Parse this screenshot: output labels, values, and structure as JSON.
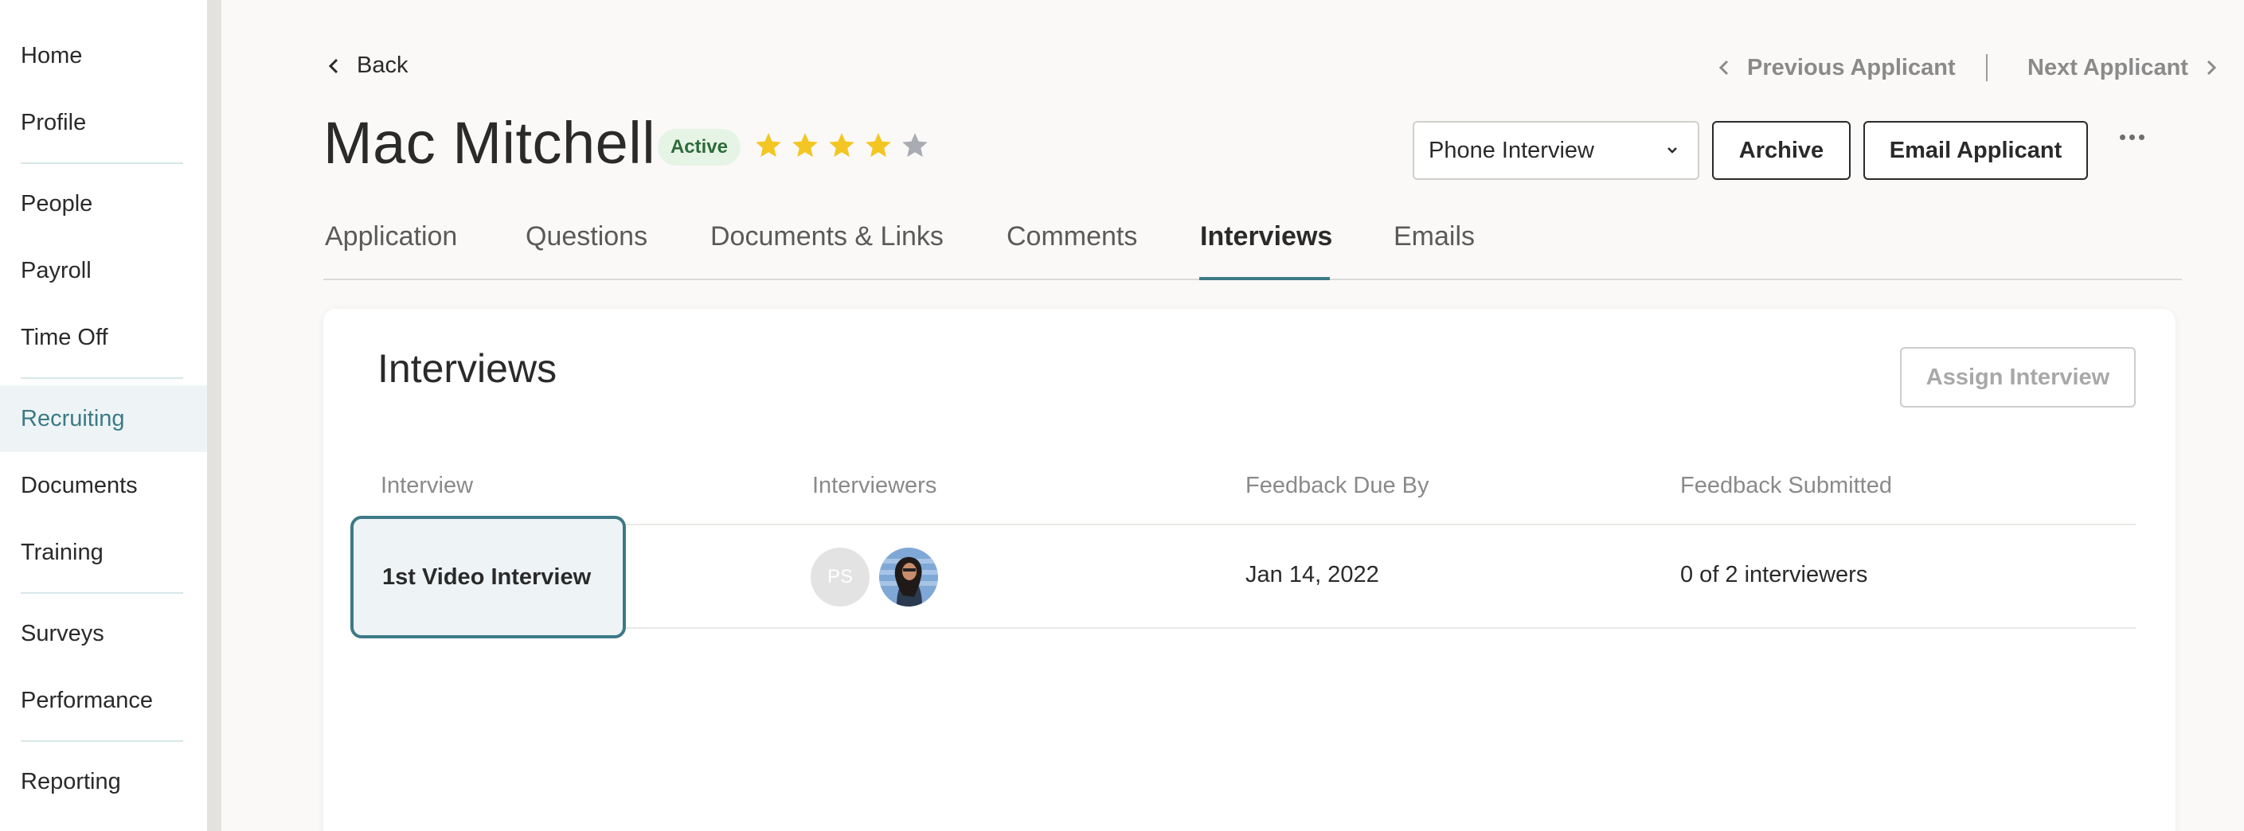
{
  "sidebar": {
    "items": [
      {
        "label": "Home"
      },
      {
        "label": "Profile"
      },
      {
        "label": "People"
      },
      {
        "label": "Payroll"
      },
      {
        "label": "Time Off"
      },
      {
        "label": "Recruiting",
        "active": true
      },
      {
        "label": "Documents"
      },
      {
        "label": "Training"
      },
      {
        "label": "Surveys"
      },
      {
        "label": "Performance"
      },
      {
        "label": "Reporting"
      }
    ]
  },
  "header": {
    "back_label": "Back",
    "previous_label": "Previous Applicant",
    "next_label": "Next Applicant"
  },
  "applicant": {
    "name": "Mac Mitchell",
    "status": "Active",
    "rating": 4,
    "rating_max": 5
  },
  "actions": {
    "stage_value": "Phone Interview",
    "archive_label": "Archive",
    "email_label": "Email Applicant"
  },
  "tabs": [
    {
      "label": "Application"
    },
    {
      "label": "Questions"
    },
    {
      "label": "Documents & Links"
    },
    {
      "label": "Comments"
    },
    {
      "label": "Interviews",
      "active": true
    },
    {
      "label": "Emails"
    }
  ],
  "interviews": {
    "title": "Interviews",
    "assign_label": "Assign Interview",
    "columns": [
      "Interview",
      "Interviewers",
      "Feedback Due By",
      "Feedback Submitted"
    ],
    "rows": [
      {
        "interview": "1st Video Interview",
        "interviewer_initials": "PS",
        "feedback_due": "Jan 14, 2022",
        "feedback_submitted": "0 of 2 interviewers"
      }
    ]
  },
  "colors": {
    "accent": "#3c7a86",
    "star_filled": "#f3c623",
    "star_empty": "#a9acb3",
    "badge_bg": "#e6f4e6",
    "badge_text": "#2f6b3a"
  }
}
